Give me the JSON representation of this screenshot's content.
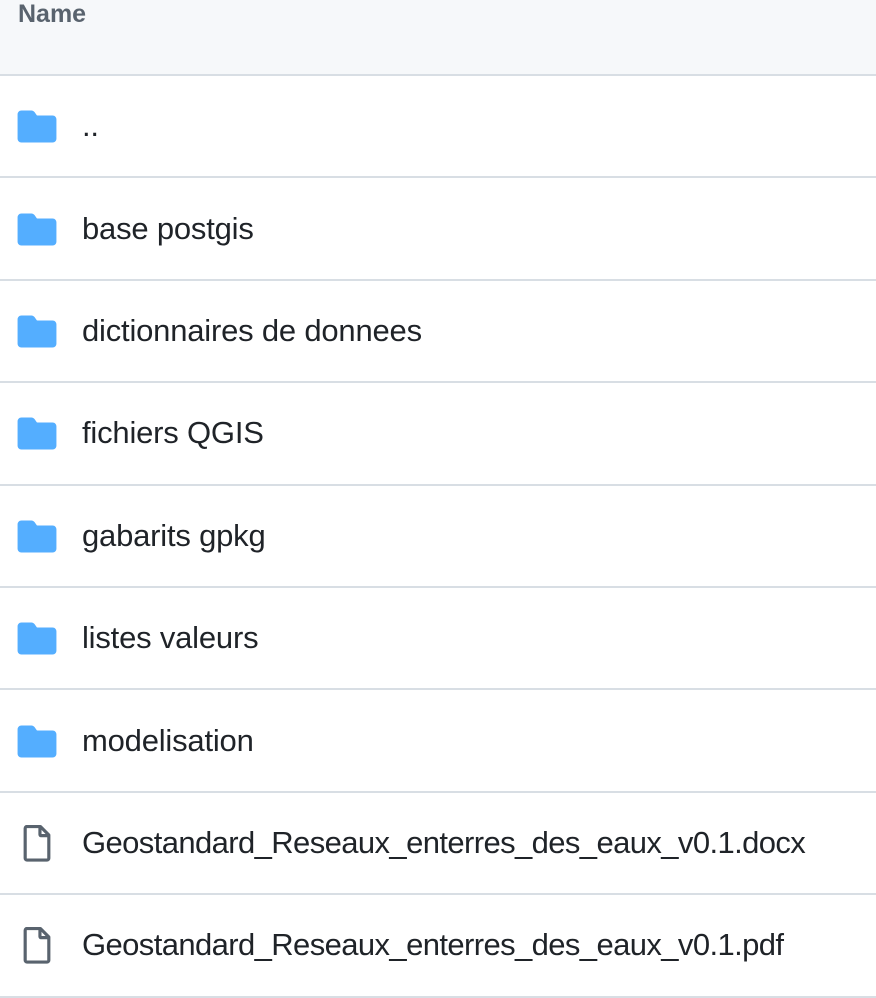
{
  "table": {
    "header": {
      "name_label": "Name"
    },
    "rows": [
      {
        "name": "..",
        "type": "folder",
        "icon": "folder-icon"
      },
      {
        "name": "base postgis",
        "type": "folder",
        "icon": "folder-icon"
      },
      {
        "name": "dictionnaires de donnees",
        "type": "folder",
        "icon": "folder-icon"
      },
      {
        "name": "fichiers QGIS",
        "type": "folder",
        "icon": "folder-icon"
      },
      {
        "name": "gabarits gpkg",
        "type": "folder",
        "icon": "folder-icon"
      },
      {
        "name": "listes valeurs",
        "type": "folder",
        "icon": "folder-icon"
      },
      {
        "name": "modelisation",
        "type": "folder",
        "icon": "folder-icon"
      },
      {
        "name": "Geostandard_Reseaux_enterres_des_eaux_v0.1.docx",
        "type": "file",
        "icon": "file-icon"
      },
      {
        "name": "Geostandard_Reseaux_enterres_des_eaux_v0.1.pdf",
        "type": "file",
        "icon": "file-icon"
      }
    ]
  },
  "colors": {
    "folder": "#54aeff",
    "file_outline": "#59636e",
    "header_bg": "#f6f8fa",
    "border": "#d8dee4",
    "text": "#1f2328"
  }
}
